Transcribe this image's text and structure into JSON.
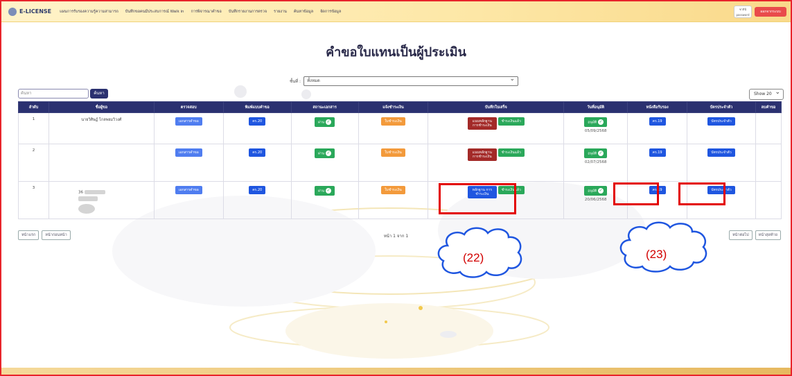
{
  "nav": {
    "logo": "E-LICENSE",
    "items": [
      "แผนการรับรองความรู้ความสามารถ",
      "บันทึกขอคนมีประสบการณ์ Walk in",
      "การพิจารณาคำขอ",
      "บันทึกรายงานการตรวจ",
      "รายงาน",
      "ค้นหาข้อมูล",
      "จัดการข้อมูล"
    ],
    "user_line1": "ชาลินี",
    "user_line2": "password",
    "logout": "ออกจากระบบ"
  },
  "page_title": "คำขอใบแทนเป็นผู้ประเมิน",
  "filter": {
    "label": "ชั้นที่ :",
    "value": "ทั้งหมด"
  },
  "search": {
    "placeholder": "ค้นหา",
    "button": "ค้นหา"
  },
  "show": {
    "value": "Show 20"
  },
  "table": {
    "headers": [
      "ลำดับ",
      "ชื่อผู้ขอ",
      "ตรวจสอบ",
      "พิมพ์แบบคำขอ",
      "สถานะเอกสาร",
      "แจ้งชำระเงิน",
      "บันทึกใบเสร็จ",
      "วันที่อนุมัติ",
      "หนังสือรับรอง",
      "บัตรประจำตัว",
      "ลบคำขอ"
    ],
    "rows": [
      {
        "no": "1",
        "name": "นายวิศิษฏ์ ไกลพยมวิวงศ์",
        "check": "เอกสารคำขอ",
        "form": "คร.20",
        "doc_status": "ผ่าน",
        "payment": "ใบชำระเงิน",
        "receipt_primary": "แนบหลักฐาน การชำระเงิน",
        "receipt_secondary": "ชำระเงินแล้ว",
        "approve": "อนุมัติ",
        "approve_date": "05/09/2568",
        "certificate": "คร.19",
        "card": "บัตรประจำตัว"
      },
      {
        "no": "2",
        "name": "",
        "check": "เอกสารคำขอ",
        "form": "คร.20",
        "doc_status": "ผ่าน",
        "payment": "ใบชำระเงิน",
        "receipt_primary": "แนบหลักฐาน การชำระเงิน",
        "receipt_secondary": "ชำระเงินแล้ว",
        "approve": "อนุมัติ",
        "approve_date": "02/07/2568",
        "certificate": "คร.19",
        "card": "บัตรประจำตัว"
      },
      {
        "no": "3",
        "name": "36",
        "check": "เอกสารคำขอ",
        "form": "คร.20",
        "doc_status": "ผ่าน",
        "payment": "ใบชำระเงิน",
        "receipt_primary": "หลักฐาน การชำระเงิน",
        "receipt_secondary": "ชำระเงินแล้ว",
        "approve": "อนุมัติ",
        "approve_date": "20/06/2568",
        "certificate": "คร.19",
        "card": "บัตรประจำตัว"
      }
    ]
  },
  "pager": {
    "first": "หน้าแรก",
    "prev": "หน้าก่อนหน้า",
    "info": "หน้า 1 จาก 1",
    "next": "หน้าต่อไป",
    "last": "หน้าสุดท้าย"
  },
  "callouts": {
    "left": "(22)",
    "right": "(23)"
  },
  "colors": {
    "navy": "#2b3170",
    "highlight": "#e30000",
    "green": "#2aa85a",
    "orange": "#f39a3b",
    "blue": "#1f56e0"
  }
}
